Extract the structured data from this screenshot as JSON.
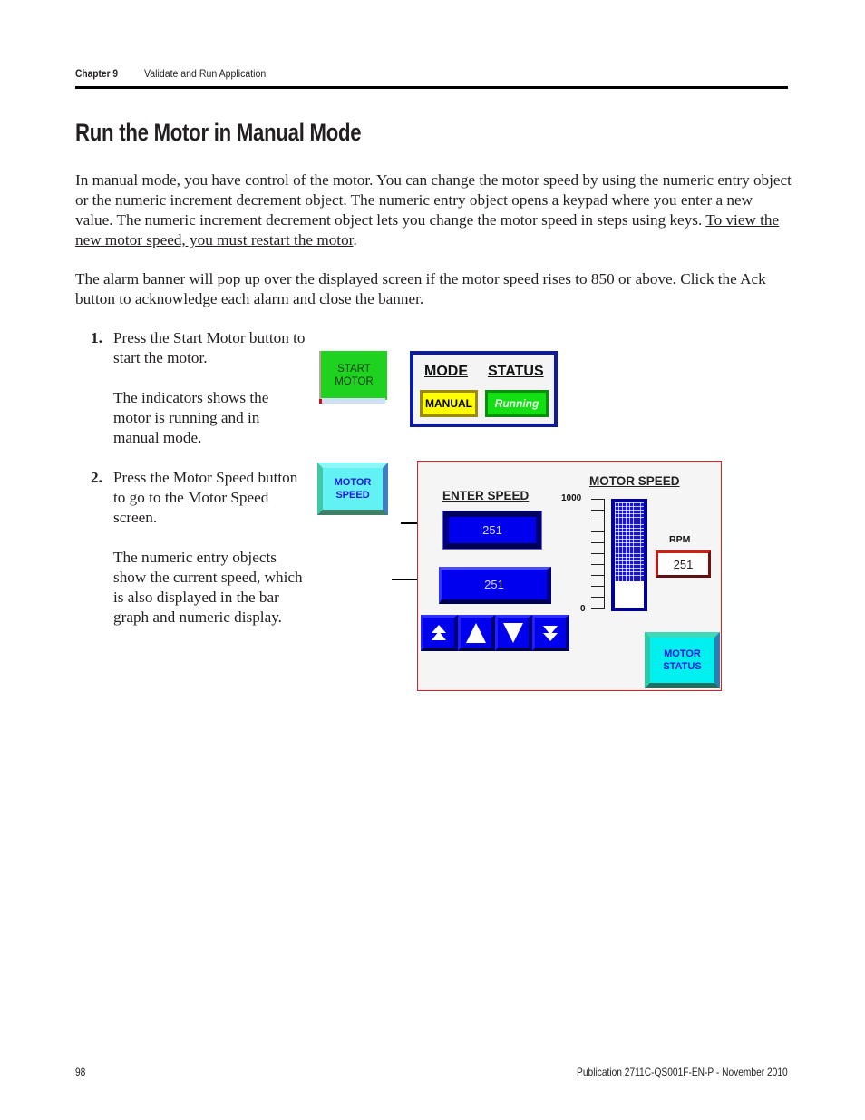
{
  "header": {
    "chapter": "Chapter 9",
    "section": "Validate and Run Application"
  },
  "page_title": "Run the Motor in Manual Mode",
  "body": {
    "para1_text": "In manual mode, you have control of the motor. You can change the motor speed by using the numeric entry object or the numeric increment decrement object. The numeric entry object opens a keypad where you enter a new value. The numeric increment decrement object lets you change the motor speed in steps using keys. ",
    "para1_underlined": "To view the new motor speed, you must restart the motor",
    "para1_end": ".",
    "para2": "The alarm banner will pop up over the displayed screen if the motor speed rises to 850 or above. Click the Ack button to acknowledge each alarm and close the banner."
  },
  "steps": [
    {
      "number": "1.",
      "text": "Press the Start Motor button to start the motor.",
      "note": "The indicators shows the motor is running and in manual mode."
    },
    {
      "number": "2.",
      "text": "Press the Motor Speed button to go to the Motor Speed screen.",
      "note": "The numeric entry objects show the current speed, which is also displayed in the bar graph and numeric display."
    }
  ],
  "start_motor_button": {
    "label_line1": "START",
    "label_line2": "MOTOR",
    "color": "#1fd21f"
  },
  "indicator_panel": {
    "mode_label": "MODE",
    "status_label": "STATUS",
    "mode_value": "MANUAL",
    "status_value": "Running",
    "mode_color": "#ffff00",
    "status_color": "#12e012",
    "border_color": "#0e1aa0"
  },
  "motor_speed_button": {
    "label_line1": "MOTOR",
    "label_line2": "SPEED",
    "color": "#63f2f4"
  },
  "speed_screen": {
    "enter_speed_label": "ENTER SPEED",
    "motor_speed_label": "MOTOR SPEED",
    "numeric_entry_value": "251",
    "inc_dec_value": "251",
    "scale_max": "1000",
    "scale_min": "0",
    "scale_ticks": 11,
    "bar_graph_fill_fraction": 0.75,
    "rpm_label": "RPM",
    "rpm_value": "251",
    "keys": [
      {
        "name": "fast-increment",
        "icon": "double-up-arrow-icon"
      },
      {
        "name": "increment",
        "icon": "up-arrow-icon"
      },
      {
        "name": "decrement",
        "icon": "down-arrow-icon"
      },
      {
        "name": "fast-decrement",
        "icon": "double-down-arrow-icon"
      }
    ],
    "motor_status_button": {
      "label_line1": "MOTOR",
      "label_line2": "STATUS"
    },
    "frame_color": "#e02020",
    "entry_color": "#0000ee"
  },
  "footer": {
    "page_number": "98",
    "publication": "Publication 2711C-QS001F-EN-P - November 2010"
  }
}
